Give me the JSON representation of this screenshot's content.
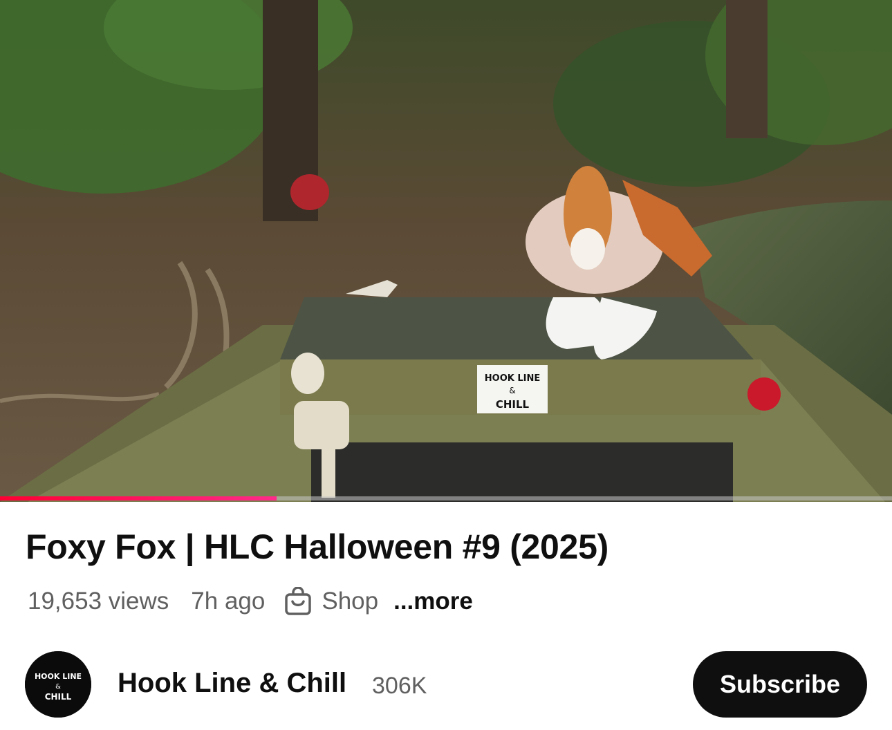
{
  "video": {
    "thumbnail_icon": "video-frame-boat-scene",
    "sign_lines": [
      "HOOK LINE",
      "&",
      "CHILL"
    ],
    "progress": {
      "fraction": 0.31,
      "fill_color": "#ff0033"
    }
  },
  "details": {
    "title": "Foxy Fox | HLC Halloween #9 (2025)",
    "views": "19,653 views",
    "age": "7h ago",
    "shop_label": "Shop",
    "shop_icon": "shopping-bag-icon",
    "more_label": "...more"
  },
  "channel": {
    "name": "Hook Line & Chill",
    "subscribers": "306K",
    "avatar_lines": [
      "HOOK LINE",
      "&",
      "CHILL"
    ],
    "subscribe_label": "Subscribe"
  },
  "colors": {
    "text_primary": "#0f0f0f",
    "text_secondary": "#606060",
    "accent": "#ff0033"
  }
}
